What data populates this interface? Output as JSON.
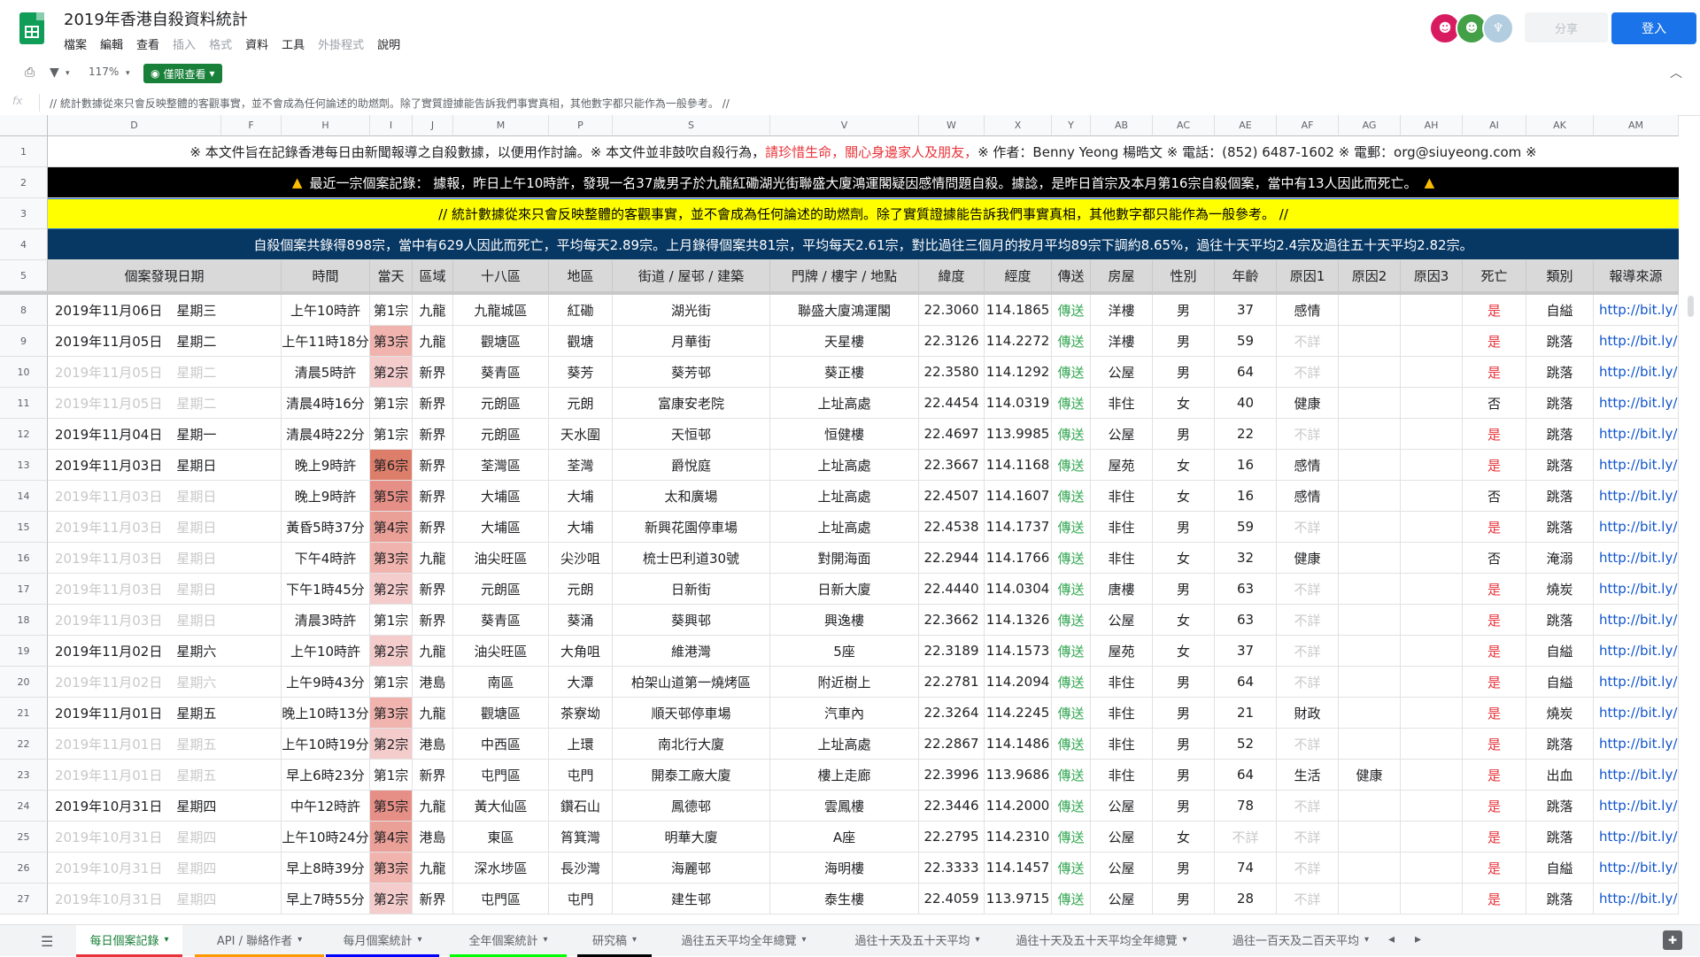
{
  "app": {
    "title": "2019年香港自殺資料統計",
    "menu": [
      "檔案",
      "編輯",
      "查看",
      "插入",
      "格式",
      "資料",
      "工具",
      "外掛程式",
      "說明"
    ],
    "menu_disabled": [
      false,
      false,
      false,
      true,
      true,
      false,
      false,
      true,
      false
    ],
    "share_label": "分享",
    "login_label": "登入"
  },
  "toolbar": {
    "print_icon": "print-icon",
    "filter_icon": "filter-icon",
    "zoom": "117%",
    "view_only_label": "僅限查看"
  },
  "formula": {
    "fx": "fx",
    "text": "// 統計數據從來只會反映整體的客觀事實，並不會成為任何論述的助燃劑。除了實質證據能告訴我們事實真相，其他數字都只能作為一般參考。 //"
  },
  "col_letters": [
    "D",
    "F",
    "H",
    "I",
    "J",
    "M",
    "P",
    "S",
    "V",
    "W",
    "X",
    "Y",
    "AB",
    "AC",
    "AE",
    "AF",
    "AG",
    "AH",
    "AI",
    "AK",
    "AM"
  ],
  "row_numbers_top": [
    "1",
    "2",
    "3",
    "4",
    "5"
  ],
  "banner": {
    "line1_a": "※ 本文件旨在記錄香港每日由新聞報導之自殺數據，以便用作討論。※ 本文件並非鼓吹自殺行為，",
    "line1_b": "請珍惜生命，關心身邊家人及朋友，",
    "line1_c": "※ 作者：Benny Yeong 楊晧文 ※ 電話：(852) 6487-1602 ※ 電郵：org@siuyeong.com ※",
    "line2": "最近一宗個案記錄：  據報，昨日上午10時許，發現一名37歲男子於九龍紅磡湖光街聯盛大廈鴻運閣疑因感情問題自殺。據諗，是昨日首宗及本月第16宗自殺個案，當中有13人因此而死亡。",
    "line3": "// 統計數據從來只會反映整體的客觀事實，並不會成為任何論述的助燃劑。除了實質證據能告訴我們事實真相，其他數字都只能作為一般參考。 //",
    "line4": "自殺個案共錄得898宗，當中有629人因此而死亡，平均每天2.89宗。上月錄得個案共81宗，平均每天2.61宗，對比過往三個月的按月平均89宗下調約8.65%，過往十天平均2.4宗及過往五十天平均2.82宗。"
  },
  "headers": [
    "個案發現日期",
    "時間",
    "當天",
    "區域",
    "十八區",
    "地區",
    "街道 / 屋邨 / 建築",
    "門牌 / 樓宇 / 地點",
    "緯度",
    "經度",
    "傳送",
    "房屋",
    "性別",
    "年齡",
    "原因1",
    "原因2",
    "原因3",
    "死亡",
    "類別",
    "報導來源"
  ],
  "rows": [
    {
      "n": "8",
      "date": "2019年11月06日",
      "wd": "星期三",
      "dim": false,
      "time": "上午10時許",
      "day": "第1宗",
      "shade": 0,
      "reg": "九龍",
      "dist18": "九龍城區",
      "area": "紅磡",
      "street": "湖光街",
      "place": "聯盛大廈鴻運閣",
      "lat": "22.3060",
      "lng": "114.1865",
      "tx": "傳送",
      "house": "洋樓",
      "sex": "男",
      "age": "37",
      "r1": "感情",
      "r1dim": false,
      "r2": "",
      "r3": "",
      "death": "是",
      "cat": "自縊",
      "src": "http://bit.ly/33mUdtV"
    },
    {
      "n": "9",
      "date": "2019年11月05日",
      "wd": "星期二",
      "dim": false,
      "time": "上午11時18分",
      "day": "第3宗",
      "shade": 2,
      "reg": "九龍",
      "dist18": "觀塘區",
      "area": "觀塘",
      "street": "月華街",
      "place": "天星樓",
      "lat": "22.3126",
      "lng": "114.2272",
      "tx": "傳送",
      "house": "洋樓",
      "sex": "男",
      "age": "59",
      "r1": "不詳",
      "r1dim": true,
      "r2": "",
      "r3": "",
      "death": "是",
      "cat": "跳落",
      "src": "http://bit.ly/2C9u3im"
    },
    {
      "n": "10",
      "date": "2019年11月05日",
      "wd": "星期二",
      "dim": true,
      "time": "清晨5時許",
      "day": "第2宗",
      "shade": 1,
      "reg": "新界",
      "dist18": "葵青區",
      "area": "葵芳",
      "street": "葵芳邨",
      "place": "葵正樓",
      "lat": "22.3580",
      "lng": "114.1292",
      "tx": "傳送",
      "house": "公屋",
      "sex": "男",
      "age": "64",
      "r1": "不詳",
      "r1dim": true,
      "r2": "",
      "r3": "",
      "death": "是",
      "cat": "跳落",
      "src": "http://bit.ly/2CdhG4Y"
    },
    {
      "n": "11",
      "date": "2019年11月05日",
      "wd": "星期二",
      "dim": true,
      "time": "清晨4時16分",
      "day": "第1宗",
      "shade": 0,
      "reg": "新界",
      "dist18": "元朗區",
      "area": "元朗",
      "street": "富康安老院",
      "place": "上址高處",
      "lat": "22.4454",
      "lng": "114.0319",
      "tx": "傳送",
      "house": "非住",
      "sex": "女",
      "age": "40",
      "r1": "健康",
      "r1dim": false,
      "r2": "",
      "r3": "",
      "death": "否",
      "cat": "跳落",
      "src": "http://bit.ly/2NhpCIA"
    },
    {
      "n": "12",
      "date": "2019年11月04日",
      "wd": "星期一",
      "dim": false,
      "time": "清晨4時22分",
      "day": "第1宗",
      "shade": 0,
      "reg": "新界",
      "dist18": "元朗區",
      "area": "天水圍",
      "street": "天恒邨",
      "place": "恒健樓",
      "lat": "22.4697",
      "lng": "113.9985",
      "tx": "傳送",
      "house": "公屋",
      "sex": "男",
      "age": "22",
      "r1": "不詳",
      "r1dim": true,
      "r2": "",
      "r3": "",
      "death": "是",
      "cat": "跳落",
      "src": "http://bit.ly/2r7JGV7"
    },
    {
      "n": "13",
      "date": "2019年11月03日",
      "wd": "星期日",
      "dim": false,
      "time": "晚上9時許",
      "day": "第6宗",
      "shade": 5,
      "reg": "新界",
      "dist18": "荃灣區",
      "area": "荃灣",
      "street": "爵悅庭",
      "place": "上址高處",
      "lat": "22.3667",
      "lng": "114.1168",
      "tx": "傳送",
      "house": "屋苑",
      "sex": "女",
      "age": "16",
      "r1": "感情",
      "r1dim": false,
      "r2": "",
      "r3": "",
      "death": "是",
      "cat": "跳落",
      "src": "http://bit.ly/2Cb9wKh"
    },
    {
      "n": "14",
      "date": "2019年11月03日",
      "wd": "星期日",
      "dim": true,
      "time": "晚上9時許",
      "day": "第5宗",
      "shade": 4,
      "reg": "新界",
      "dist18": "大埔區",
      "area": "大埔",
      "street": "太和廣場",
      "place": "上址高處",
      "lat": "22.4507",
      "lng": "114.1607",
      "tx": "傳送",
      "house": "非住",
      "sex": "女",
      "age": "16",
      "r1": "感情",
      "r1dim": false,
      "r2": "",
      "r3": "",
      "death": "否",
      "cat": "跳落",
      "src": "http://bit.ly/2C9N586"
    },
    {
      "n": "15",
      "date": "2019年11月03日",
      "wd": "星期日",
      "dim": true,
      "time": "黃昏5時37分",
      "day": "第4宗",
      "shade": 3,
      "reg": "新界",
      "dist18": "大埔區",
      "area": "大埔",
      "street": "新興花園停車場",
      "place": "上址高處",
      "lat": "22.4538",
      "lng": "114.1737",
      "tx": "傳送",
      "house": "非住",
      "sex": "男",
      "age": "59",
      "r1": "不詳",
      "r1dim": true,
      "r2": "",
      "r3": "",
      "death": "是",
      "cat": "跳落",
      "src": "http://bit.ly/2JKmC5n"
    },
    {
      "n": "16",
      "date": "2019年11月03日",
      "wd": "星期日",
      "dim": true,
      "time": "下午4時許",
      "day": "第3宗",
      "shade": 2,
      "reg": "九龍",
      "dist18": "油尖旺區",
      "area": "尖沙咀",
      "street": "梳士巴利道30號",
      "place": "對開海面",
      "lat": "22.2944",
      "lng": "114.1766",
      "tx": "傳送",
      "house": "非住",
      "sex": "女",
      "age": "32",
      "r1": "健康",
      "r1dim": false,
      "r2": "",
      "r3": "",
      "death": "否",
      "cat": "淹溺",
      "src": "http://bit.ly/2psFBdU"
    },
    {
      "n": "17",
      "date": "2019年11月03日",
      "wd": "星期日",
      "dim": true,
      "time": "下午1時45分",
      "day": "第2宗",
      "shade": 1,
      "reg": "新界",
      "dist18": "元朗區",
      "area": "元朗",
      "street": "日新街",
      "place": "日新大廈",
      "lat": "22.4440",
      "lng": "114.0304",
      "tx": "傳送",
      "house": "唐樓",
      "sex": "男",
      "age": "63",
      "r1": "不詳",
      "r1dim": true,
      "r2": "",
      "r3": "",
      "death": "是",
      "cat": "燒炭",
      "src": "http://bit.ly/2JLx3Wc"
    },
    {
      "n": "18",
      "date": "2019年11月03日",
      "wd": "星期日",
      "dim": true,
      "time": "清晨3時許",
      "day": "第1宗",
      "shade": 0,
      "reg": "新界",
      "dist18": "葵青區",
      "area": "葵涌",
      "street": "葵興邨",
      "place": "興逸樓",
      "lat": "22.3662",
      "lng": "114.1326",
      "tx": "傳送",
      "house": "公屋",
      "sex": "女",
      "age": "63",
      "r1": "不詳",
      "r1dim": true,
      "r2": "",
      "r3": "",
      "death": "是",
      "cat": "跳落",
      "src": "http://bit.ly/36vQrjG"
    },
    {
      "n": "19",
      "date": "2019年11月02日",
      "wd": "星期六",
      "dim": false,
      "time": "上午10時許",
      "day": "第2宗",
      "shade": 1,
      "reg": "九龍",
      "dist18": "油尖旺區",
      "area": "大角咀",
      "street": "維港灣",
      "place": "5座",
      "lat": "22.3189",
      "lng": "114.1573",
      "tx": "傳送",
      "house": "屋苑",
      "sex": "女",
      "age": "37",
      "r1": "不詳",
      "r1dim": true,
      "r2": "",
      "r3": "",
      "death": "是",
      "cat": "自縊",
      "src": "http://bit.ly/2qYOWu6"
    },
    {
      "n": "20",
      "date": "2019年11月02日",
      "wd": "星期六",
      "dim": true,
      "time": "上午9時43分",
      "day": "第1宗",
      "shade": 0,
      "reg": "港島",
      "dist18": "南區",
      "area": "大潭",
      "street": "柏架山道第一燒烤區",
      "place": "附近樹上",
      "lat": "22.2781",
      "lng": "114.2094",
      "tx": "傳送",
      "house": "非住",
      "sex": "男",
      "age": "64",
      "r1": "不詳",
      "r1dim": true,
      "r2": "",
      "r3": "",
      "death": "是",
      "cat": "自縊",
      "src": "http://bit.ly/2NynQ4J"
    },
    {
      "n": "21",
      "date": "2019年11月01日",
      "wd": "星期五",
      "dim": false,
      "time": "晚上10時13分",
      "day": "第3宗",
      "shade": 2,
      "reg": "九龍",
      "dist18": "觀塘區",
      "area": "茶寮坳",
      "street": "順天邨停車場",
      "place": "汽車內",
      "lat": "22.3264",
      "lng": "114.2245",
      "tx": "傳送",
      "house": "非住",
      "sex": "男",
      "age": "21",
      "r1": "財政",
      "r1dim": false,
      "r2": "",
      "r3": "",
      "death": "是",
      "cat": "燒炭",
      "src": "http://bit.ly/325piRw"
    },
    {
      "n": "22",
      "date": "2019年11月01日",
      "wd": "星期五",
      "dim": true,
      "time": "上午10時19分",
      "day": "第2宗",
      "shade": 1,
      "reg": "港島",
      "dist18": "中西區",
      "area": "上環",
      "street": "南北行大廈",
      "place": "上址高處",
      "lat": "22.2867",
      "lng": "114.1486",
      "tx": "傳送",
      "house": "非住",
      "sex": "男",
      "age": "52",
      "r1": "不詳",
      "r1dim": true,
      "r2": "",
      "r3": "",
      "death": "是",
      "cat": "跳落",
      "src": "http://bit.ly/3351cYp"
    },
    {
      "n": "23",
      "date": "2019年11月01日",
      "wd": "星期五",
      "dim": true,
      "time": "早上6時23分",
      "day": "第1宗",
      "shade": 0,
      "reg": "新界",
      "dist18": "屯門區",
      "area": "屯門",
      "street": "開泰工廠大廈",
      "place": "樓上走廊",
      "lat": "22.3996",
      "lng": "113.9686",
      "tx": "傳送",
      "house": "非住",
      "sex": "男",
      "age": "64",
      "r1": "生活",
      "r1dim": false,
      "r2": "健康",
      "r3": "",
      "death": "是",
      "cat": "出血",
      "src": "http://bit.ly/2JFm5BF"
    },
    {
      "n": "24",
      "date": "2019年10月31日",
      "wd": "星期四",
      "dim": false,
      "time": "中午12時許",
      "day": "第5宗",
      "shade": 4,
      "reg": "九龍",
      "dist18": "黃大仙區",
      "area": "鑽石山",
      "street": "鳳德邨",
      "place": "雲鳳樓",
      "lat": "22.3446",
      "lng": "114.2000",
      "tx": "傳送",
      "house": "公屋",
      "sex": "男",
      "age": "78",
      "r1": "不詳",
      "r1dim": true,
      "r2": "",
      "r3": "",
      "death": "是",
      "cat": "跳落",
      "src": "http://bit.ly/2PBXv8v"
    },
    {
      "n": "25",
      "date": "2019年10月31日",
      "wd": "星期四",
      "dim": true,
      "time": "上午10時24分",
      "day": "第4宗",
      "shade": 3,
      "reg": "港島",
      "dist18": "東區",
      "area": "筲箕灣",
      "street": "明華大廈",
      "place": "A座",
      "lat": "22.2795",
      "lng": "114.2310",
      "tx": "傳送",
      "house": "公屋",
      "sex": "女",
      "age": "不詳",
      "r1": "不詳",
      "r1dim": true,
      "r2": "",
      "r3": "",
      "death": "是",
      "cat": "跳落",
      "src": "http://bit.ly/2prJuQ8"
    },
    {
      "n": "26",
      "date": "2019年10月31日",
      "wd": "星期四",
      "dim": true,
      "time": "早上8時39分",
      "day": "第3宗",
      "shade": 2,
      "reg": "九龍",
      "dist18": "深水埗區",
      "area": "長沙灣",
      "street": "海麗邨",
      "place": "海明樓",
      "lat": "22.3333",
      "lng": "114.1457",
      "tx": "傳送",
      "house": "公屋",
      "sex": "男",
      "age": "74",
      "r1": "不詳",
      "r1dim": true,
      "r2": "",
      "r3": "",
      "death": "是",
      "cat": "自縊",
      "src": "http://bit.ly/2NkEzbu"
    },
    {
      "n": "27",
      "date": "2019年10月31日",
      "wd": "星期四",
      "dim": true,
      "time": "早上7時55分",
      "day": "第2宗",
      "shade": 1,
      "reg": "新界",
      "dist18": "屯門區",
      "area": "屯門",
      "street": "建生邨",
      "place": "泰生樓",
      "lat": "22.4059",
      "lng": "113.9715",
      "tx": "傳送",
      "house": "公屋",
      "sex": "男",
      "age": "28",
      "r1": "不詳",
      "r1dim": true,
      "r2": "",
      "r3": "",
      "death": "是",
      "cat": "跳落",
      "src": "http://bit.ly/36m8B7G"
    }
  ],
  "tabs": [
    {
      "label": "每日個案記錄",
      "active": true,
      "color": "#e8333a"
    },
    {
      "label": "API / 聯絡作者",
      "active": false,
      "color": "#ff9900"
    },
    {
      "label": "每月個案統計",
      "active": false,
      "color": "#0000ff"
    },
    {
      "label": "全年個案統計",
      "active": false,
      "color": "#00ff00"
    },
    {
      "label": "研究稿",
      "active": false,
      "color": "#000000"
    },
    {
      "label": "過往五天平均全年總覽",
      "active": false,
      "color": ""
    },
    {
      "label": "過往十天及五十天平均",
      "active": false,
      "color": ""
    },
    {
      "label": "過往十天及五十天平均全年總覽",
      "active": false,
      "color": ""
    },
    {
      "label": "過往一百天及二百天平均",
      "active": false,
      "color": ""
    }
  ],
  "colors": {
    "day_shades": [
      "#ffffff",
      "#f4cccc",
      "#f0b3ad",
      "#ea9f97",
      "#e68f86",
      "#dd7e6b"
    ]
  }
}
